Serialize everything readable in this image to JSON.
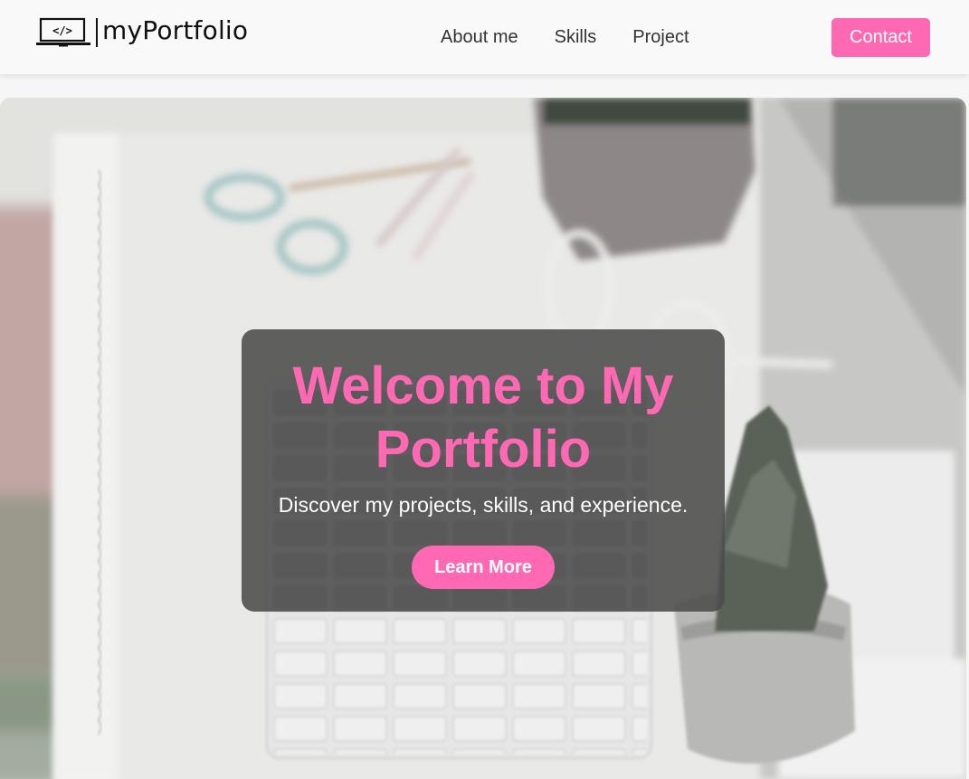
{
  "navbar": {
    "logo_icon_text": "</>",
    "logo_text": "myPortfolio",
    "links": [
      {
        "label": "About me"
      },
      {
        "label": "Skills"
      },
      {
        "label": "Project"
      }
    ],
    "contact_label": "Contact"
  },
  "hero": {
    "background": "blurred-desk-photo",
    "title": "Welcome to My Portfolio",
    "subtitle": "Discover my projects, skills, and experience.",
    "button_label": "Learn More"
  },
  "colors": {
    "accent": "#ff69b4",
    "navbar_bg": "#f9f9f9",
    "card_bg": "#4b4b4b",
    "text_dark": "#333333",
    "text_light": "#ffffff"
  },
  "icons": {
    "logo": "laptop-code-icon"
  }
}
